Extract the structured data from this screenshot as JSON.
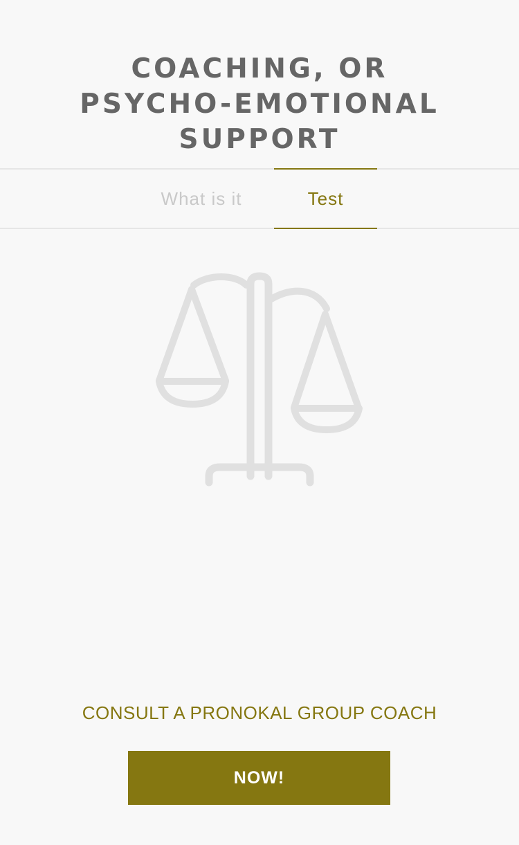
{
  "header": {
    "title": "COACHING, OR\nPSYCHO-EMOTIONAL\nSUPPORT"
  },
  "tabs": [
    {
      "label": "What is it",
      "active": false
    },
    {
      "label": "Test",
      "active": true
    }
  ],
  "illustration": {
    "icon": "balance-scale-icon",
    "color": "#e0e0e0"
  },
  "cta": {
    "text": "CONSULT A PRONOKAL GROUP COACH",
    "button_label": "NOW!"
  },
  "colors": {
    "accent": "#857711",
    "title": "#666666",
    "inactive_tab": "#c9c9c9",
    "background": "#f8f8f8"
  }
}
